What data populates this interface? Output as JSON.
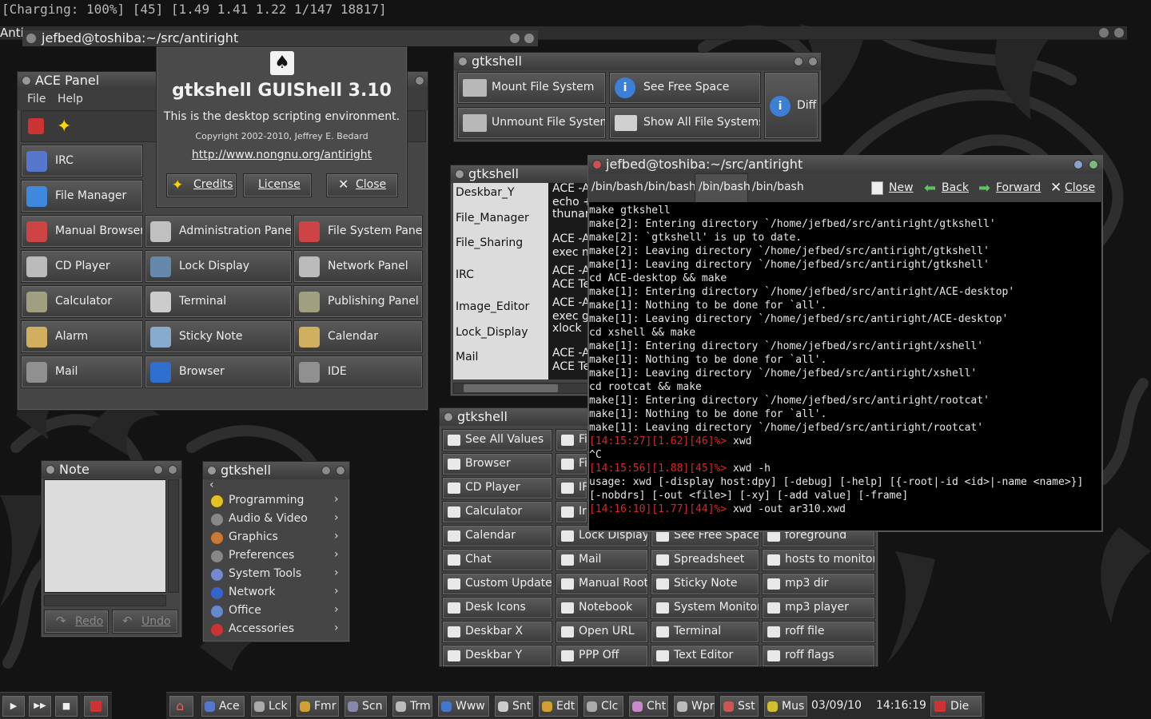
{
  "statusbar": {
    "text": "[Charging:  100%] [45] [1.49 1.41 1.22 1/147 18817]"
  },
  "bg_titles": {
    "t1": "Anti",
    "t2": "jefbed@toshiba:~/src/antiright"
  },
  "ace_panel": {
    "title": "ACE Panel",
    "menu": [
      "File",
      "Help"
    ],
    "col1": [
      "IRC",
      "File Manager",
      "Manual Browser",
      "CD Player",
      "Calculator",
      "Alarm",
      "Mail"
    ],
    "col2": [
      "Administration Panel",
      "Lock Display",
      "Terminal",
      "Sticky Note",
      "Browser"
    ],
    "col3": [
      "File System Panel",
      "Network Panel",
      "Publishing Panel",
      "Calendar",
      "IDE"
    ]
  },
  "about": {
    "title": "gtkshell GUIShell 3.10",
    "desc": "This is the desktop scripting environment.",
    "copyright": "Copyright 2002-2010, Jeffrey E. Bedard",
    "url": "http://www.nongnu.org/antiright",
    "buttons": [
      "Credits",
      "License",
      "Close"
    ]
  },
  "fs_panel": {
    "title": "gtkshell",
    "buttons": [
      "Mount File System",
      "See Free Space",
      "Unmount File System",
      "Show All File Systems",
      "Diff"
    ]
  },
  "table_win": {
    "title": "gtkshell",
    "rows": [
      {
        "name": "Deskbar_Y",
        "v1": "ACE -A",
        "v2": "echo +"
      },
      {
        "name": "File_Manager",
        "v1": "thunar",
        "v2": ""
      },
      {
        "name": "File_Sharing",
        "v1": "ACE -A",
        "v2": "exec n"
      },
      {
        "name": "IRC",
        "v1": "ACE -A",
        "v2": "ACE Te"
      },
      {
        "name": "Image_Editor",
        "v1": "ACE -A",
        "v2": "exec g"
      },
      {
        "name": "Lock_Display",
        "v1": "xlock",
        "v2": ""
      },
      {
        "name": "Mail",
        "v1": "ACE -A",
        "v2": "ACE Te"
      }
    ]
  },
  "terminal": {
    "title": "jefbed@toshiba:~/src/antiright",
    "tabs": [
      "/bin/bash",
      "/bin/bash",
      "/bin/bash",
      "/bin/bash"
    ],
    "actions": [
      "New",
      "Back",
      "Forward",
      "Close"
    ],
    "lines": [
      {
        "p": "",
        "c": "make gtkshell"
      },
      {
        "p": "",
        "c": "make[2]: Entering directory `/home/jefbed/src/antiright/gtkshell'"
      },
      {
        "p": "",
        "c": "make[2]: `gtkshell' is up to date."
      },
      {
        "p": "",
        "c": "make[2]: Leaving directory `/home/jefbed/src/antiright/gtkshell'"
      },
      {
        "p": "",
        "c": "make[1]: Leaving directory `/home/jefbed/src/antiright/gtkshell'"
      },
      {
        "p": "",
        "c": "cd ACE-desktop && make"
      },
      {
        "p": "",
        "c": "make[1]: Entering directory `/home/jefbed/src/antiright/ACE-desktop'"
      },
      {
        "p": "",
        "c": "make[1]: Nothing to be done for `all'."
      },
      {
        "p": "",
        "c": "make[1]: Leaving directory `/home/jefbed/src/antiright/ACE-desktop'"
      },
      {
        "p": "",
        "c": "cd xshell && make"
      },
      {
        "p": "",
        "c": "make[1]: Entering directory `/home/jefbed/src/antiright/xshell'"
      },
      {
        "p": "",
        "c": "make[1]: Nothing to be done for `all'."
      },
      {
        "p": "",
        "c": "make[1]: Leaving directory `/home/jefbed/src/antiright/xshell'"
      },
      {
        "p": "",
        "c": "cd rootcat && make"
      },
      {
        "p": "",
        "c": "make[1]: Entering directory `/home/jefbed/src/antiright/rootcat'"
      },
      {
        "p": "",
        "c": "make[1]: Nothing to be done for `all'."
      },
      {
        "p": "",
        "c": "make[1]: Leaving directory `/home/jefbed/src/antiright/rootcat'"
      },
      {
        "p": "[14:15:27][1.62][46]%>",
        "c": " xwd"
      },
      {
        "p": "",
        "c": "^C"
      },
      {
        "p": "[14:15:56][1.88][45]%>",
        "c": " xwd -h"
      },
      {
        "p": "",
        "c": "usage: xwd [-display host:dpy] [-debug] [-help] [{-root|-id <id>|-name <name>}]"
      },
      {
        "p": "",
        "c": "[-nobdrs] [-out <file>] [-xy] [-add value] [-frame]"
      },
      {
        "p": "[14:16:10][1.77][44]%>",
        "c": " xwd -out ar310.xwd"
      }
    ]
  },
  "launcher": {
    "title": "gtkshell",
    "col1": [
      "See All Values",
      "Browser",
      "CD Player",
      "Calculator",
      "Calendar",
      "Chat",
      "Custom Updater",
      "Desk Icons",
      "Deskbar X",
      "Deskbar Y"
    ],
    "col2_partial": [
      "Fi",
      "Fi",
      "IF",
      "In"
    ],
    "col2": [
      "Lock Display",
      "Mail",
      "Manual Root",
      "Notebook",
      "Open URL",
      "PPP Off"
    ],
    "col3": [
      "See Free Space",
      "Spreadsheet",
      "Sticky Note",
      "System Monitor",
      "Terminal",
      "Text Editor"
    ],
    "col4": [
      "foreground",
      "hosts to monitor",
      "mp3 dir",
      "mp3 player",
      "roff file",
      "roff flags"
    ]
  },
  "note": {
    "title": "Note",
    "buttons": [
      "Redo",
      "Undo"
    ]
  },
  "menu": {
    "title": "gtkshell",
    "items": [
      "Programming",
      "Audio & Video",
      "Graphics",
      "Preferences",
      "System Tools",
      "Network",
      "Office",
      "Accessories"
    ],
    "colors": [
      "#e8c020",
      "#888888",
      "#cc7733",
      "#888888",
      "#7788cc",
      "#3366cc",
      "#6688cc",
      "#cc3333"
    ]
  },
  "taskbar": {
    "items": [
      "Ace",
      "Lck",
      "Fmr",
      "Scn",
      "Trm",
      "Www",
      "Snt",
      "Edt",
      "Clc",
      "Cht",
      "Wpr",
      "Sst",
      "Mus"
    ],
    "date": "03/09/10",
    "time": "14:16:19",
    "die": "Die"
  }
}
